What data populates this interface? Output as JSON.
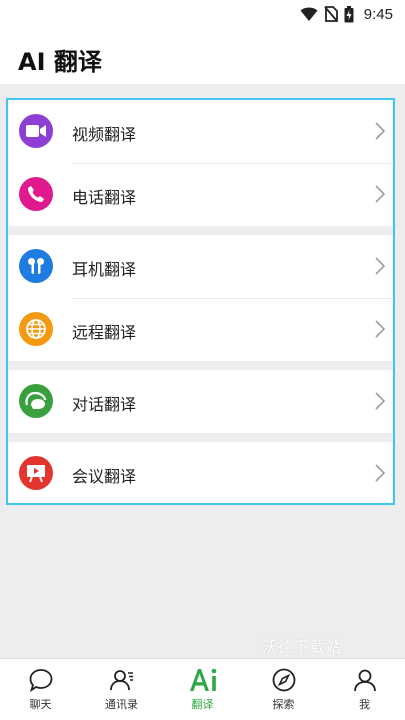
{
  "status_bar": {
    "time": "9:45",
    "icons": [
      "wifi-icon",
      "no-sim-icon",
      "battery-icon"
    ]
  },
  "header": {
    "title": "AI 翻译"
  },
  "colors": {
    "accent": "#2ea845",
    "highlight_border": "#3ec5f0"
  },
  "groups": [
    {
      "items": [
        {
          "label": "视频翻译",
          "icon": "video-icon",
          "color": "#8e3fd3"
        },
        {
          "label": "电话翻译",
          "icon": "phone-icon",
          "color": "#e0198e"
        }
      ]
    },
    {
      "items": [
        {
          "label": "耳机翻译",
          "icon": "earbuds-icon",
          "color": "#1e7be0"
        },
        {
          "label": "远程翻译",
          "icon": "globe-icon",
          "color": "#f39a12"
        }
      ]
    },
    {
      "items": [
        {
          "label": "对话翻译",
          "icon": "conversation-icon",
          "color": "#3aa03e"
        }
      ]
    },
    {
      "items": [
        {
          "label": "会议翻译",
          "icon": "presentation-icon",
          "color": "#e3352e"
        }
      ]
    }
  ],
  "bottom_nav": {
    "items": [
      {
        "label": "聊天",
        "icon": "chat-icon",
        "active": false
      },
      {
        "label": "通讯录",
        "icon": "contacts-icon",
        "active": false
      },
      {
        "label": "翻译",
        "icon": "ai-translate-icon",
        "active": true
      },
      {
        "label": "探索",
        "icon": "compass-icon",
        "active": false
      },
      {
        "label": "我",
        "icon": "profile-icon",
        "active": false
      }
    ]
  },
  "watermark": "沃德下载站"
}
